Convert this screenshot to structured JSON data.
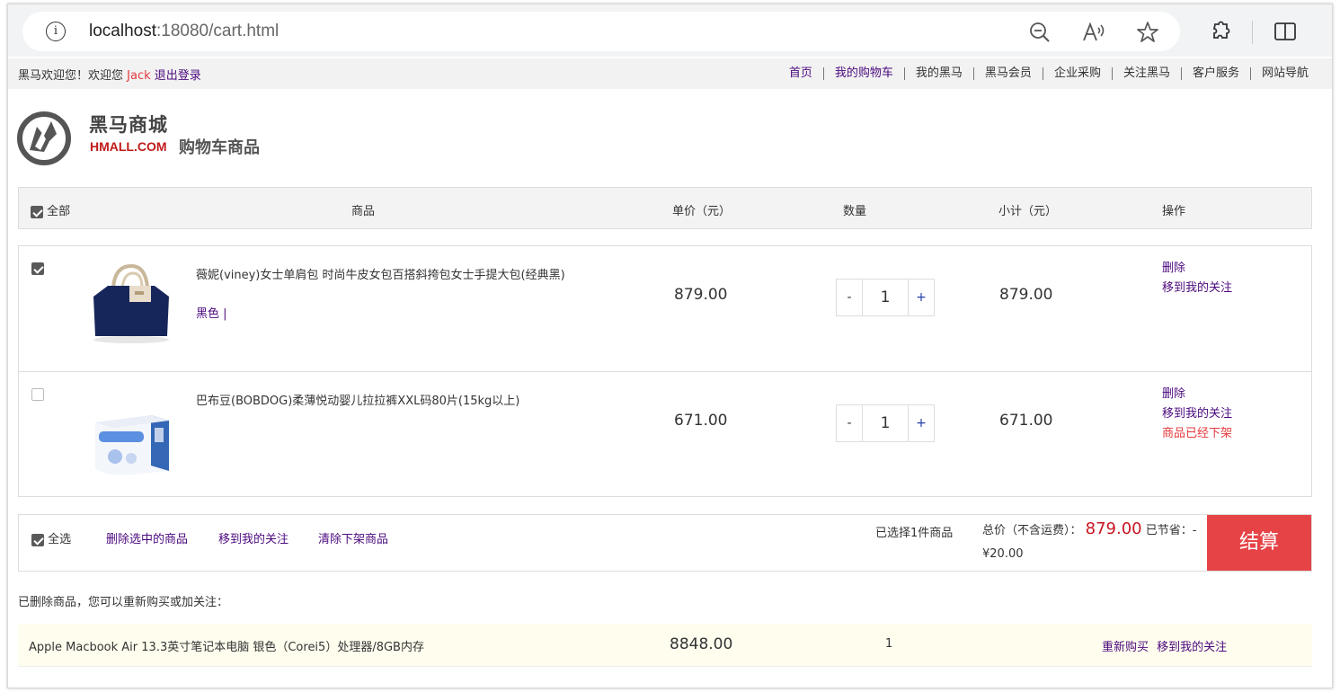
{
  "browser": {
    "url_host": "localhost",
    "url_rest": ":18080/cart.html",
    "icons": [
      "info-icon",
      "zoom-out-icon",
      "read-aloud-icon",
      "favorite-star-icon",
      "extensions-icon",
      "split-screen-icon"
    ]
  },
  "topnav": {
    "welcome_prefix": "黑马欢迎您！欢迎您",
    "username": "Jack",
    "logout": "退出登录",
    "links": [
      "首页",
      "我的购物车",
      "我的黑马",
      "黑马会员",
      "企业采购",
      "关注黑马",
      "客户服务",
      "网站导航"
    ]
  },
  "header": {
    "logo_title": "黑马商城",
    "logo_sub": "HMALL.COM",
    "page_title": "购物车商品"
  },
  "table_header": {
    "select_all": "全部",
    "product": "商品",
    "unit_price": "单价（元）",
    "quantity": "数量",
    "subtotal": "小计（元）",
    "actions": "操作"
  },
  "items": [
    {
      "checked": true,
      "name": "薇妮(viney)女士单肩包 时尚牛皮女包百搭斜挎包女士手提大包(经典黑)",
      "attr": "黑色 |",
      "price": "879.00",
      "qty": "1",
      "subtotal": "879.00",
      "ops": [
        "删除",
        "移到我的关注"
      ],
      "status": ""
    },
    {
      "checked": false,
      "name": "巴布豆(BOBDOG)柔薄悦动婴儿拉拉裤XXL码80片(15kg以上)",
      "attr": "",
      "price": "671.00",
      "qty": "1",
      "subtotal": "671.00",
      "ops": [
        "删除",
        "移到我的关注"
      ],
      "status": "商品已经下架"
    }
  ],
  "qty_controls": {
    "minus": "-",
    "plus": "+"
  },
  "checkout": {
    "select_all": "全选",
    "actions": [
      "删除选中的商品",
      "移到我的关注",
      "清除下架商品"
    ],
    "selected_count": "已选择1件商品",
    "total_label": "总价（不含运费）：",
    "total_amount": "879.00",
    "saved_label": "已节省：-¥20.00",
    "button": "结算"
  },
  "deleted": {
    "note": "已删除商品，您可以重新购买或加关注：",
    "name": "Apple Macbook Air 13.3英寸笔记本电脑 银色（Corei5）处理器/8GB内存",
    "price": "8848.00",
    "qty": "1",
    "ops": [
      "重新购买",
      "移到我的关注"
    ]
  },
  "colors": {
    "accent_red": "#e64346",
    "link_purple": "#4b0a7e",
    "price_red": "#c81623"
  }
}
